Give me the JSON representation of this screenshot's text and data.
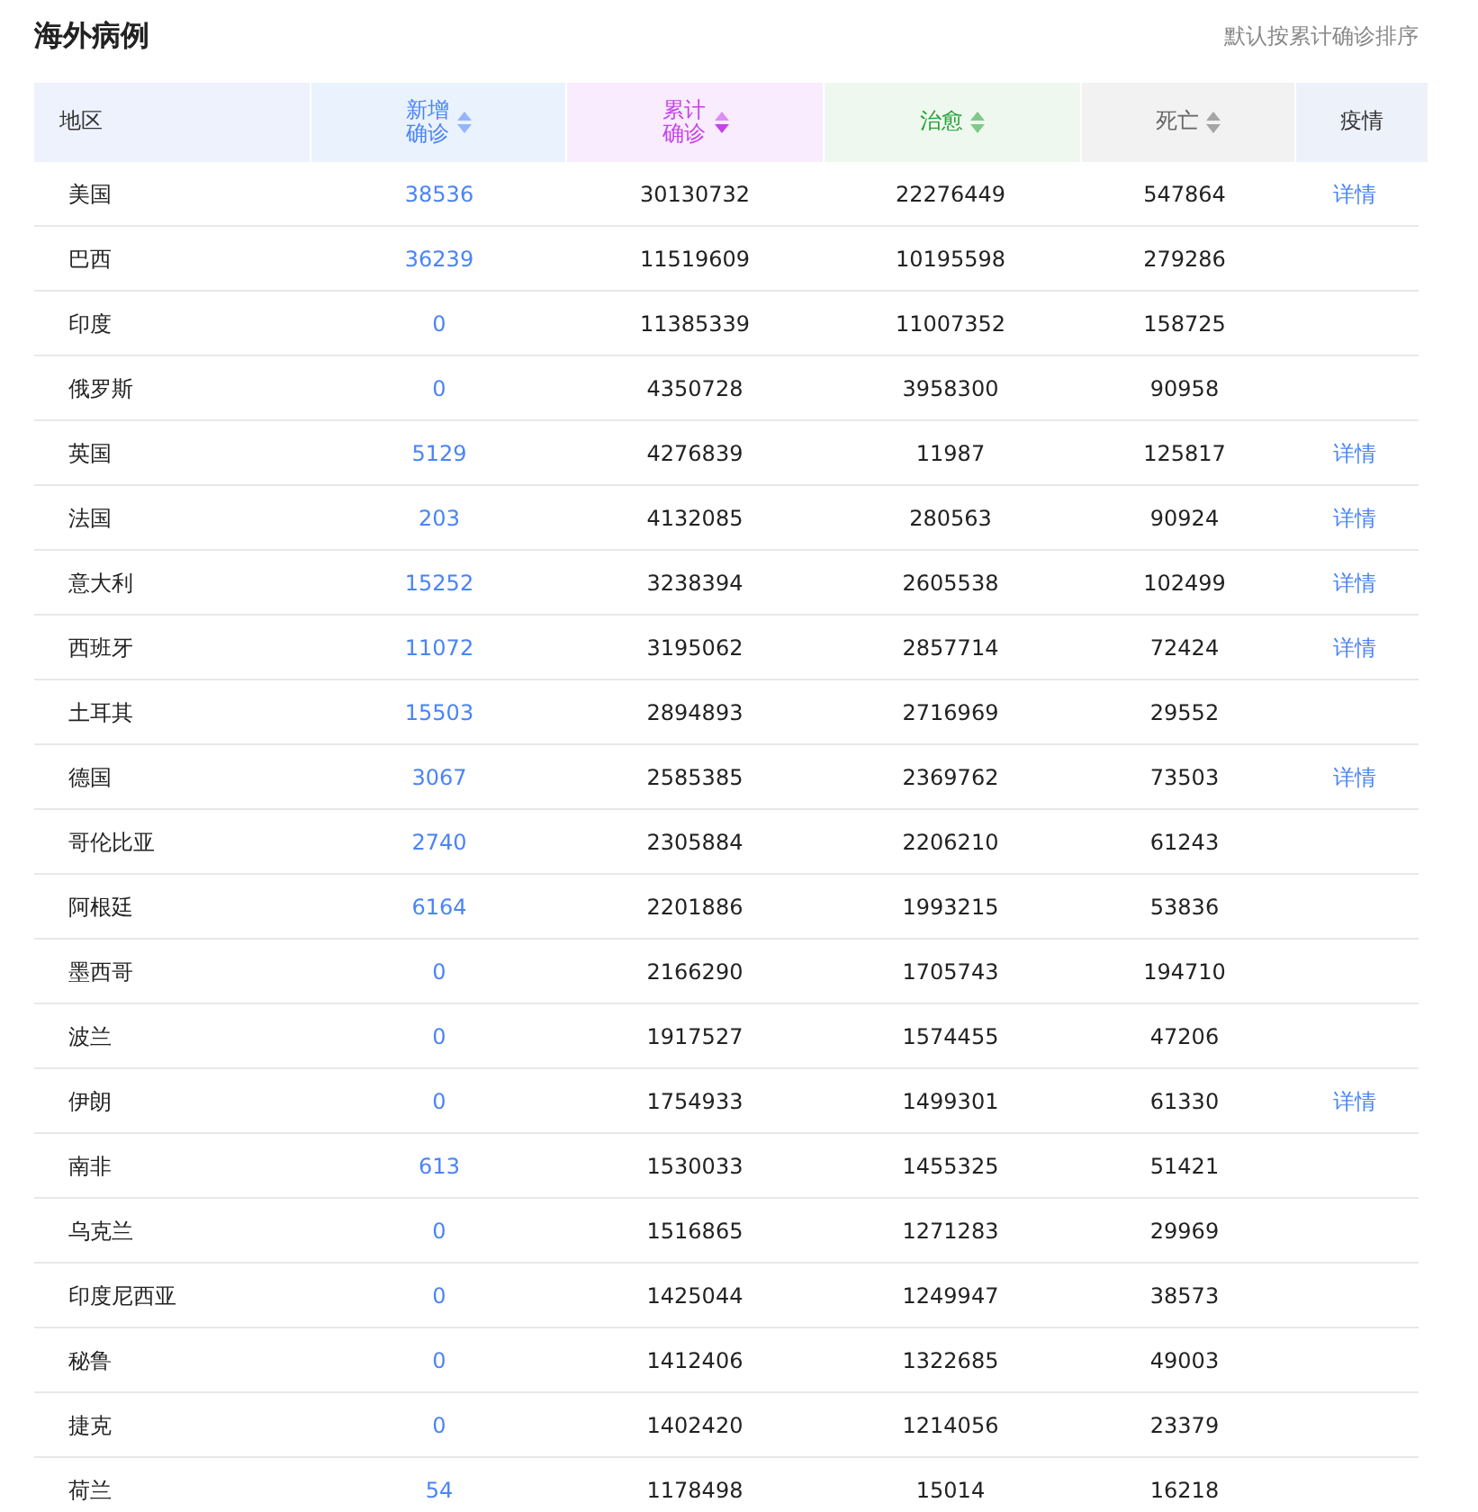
{
  "title": "海外病例",
  "sort_note": "默认按累计确诊排序",
  "columns": [
    {
      "label": "地区",
      "sortable": false,
      "color": "#333333"
    },
    {
      "label": "新增确诊",
      "sortable": true,
      "sorted": false,
      "color": "#4b84f7"
    },
    {
      "label": "累计确诊",
      "sortable": true,
      "sorted": true,
      "color": "#c542ea"
    },
    {
      "label": "治愈",
      "sortable": true,
      "sorted": false,
      "color": "#24a338"
    },
    {
      "label": "死亡",
      "sortable": true,
      "sorted": false,
      "color": "#666666"
    },
    {
      "label": "疫情",
      "sortable": false,
      "color": "#333333"
    }
  ],
  "rows": [
    {
      "region": "美国",
      "new": "38536",
      "total": "30130732",
      "cured": "22276449",
      "dead": "547864",
      "detail": "详情"
    },
    {
      "region": "巴西",
      "new": "36239",
      "total": "11519609",
      "cured": "10195598",
      "dead": "279286"
    },
    {
      "region": "印度",
      "new": "0",
      "total": "11385339",
      "cured": "11007352",
      "dead": "158725"
    },
    {
      "region": "俄罗斯",
      "new": "0",
      "total": "4350728",
      "cured": "3958300",
      "dead": "90958"
    },
    {
      "region": "英国",
      "new": "5129",
      "total": "4276839",
      "cured": "11987",
      "dead": "125817",
      "detail": "详情"
    },
    {
      "region": "法国",
      "new": "203",
      "total": "4132085",
      "cured": "280563",
      "dead": "90924",
      "detail": "详情"
    },
    {
      "region": "意大利",
      "new": "15252",
      "total": "3238394",
      "cured": "2605538",
      "dead": "102499",
      "detail": "详情"
    },
    {
      "region": "西班牙",
      "new": "11072",
      "total": "3195062",
      "cured": "2857714",
      "dead": "72424",
      "detail": "详情"
    },
    {
      "region": "土耳其",
      "new": "15503",
      "total": "2894893",
      "cured": "2716969",
      "dead": "29552"
    },
    {
      "region": "德国",
      "new": "3067",
      "total": "2585385",
      "cured": "2369762",
      "dead": "73503",
      "detail": "详情"
    },
    {
      "region": "哥伦比亚",
      "new": "2740",
      "total": "2305884",
      "cured": "2206210",
      "dead": "61243"
    },
    {
      "region": "阿根廷",
      "new": "6164",
      "total": "2201886",
      "cured": "1993215",
      "dead": "53836"
    },
    {
      "region": "墨西哥",
      "new": "0",
      "total": "2166290",
      "cured": "1705743",
      "dead": "194710"
    },
    {
      "region": "波兰",
      "new": "0",
      "total": "1917527",
      "cured": "1574455",
      "dead": "47206"
    },
    {
      "region": "伊朗",
      "new": "0",
      "total": "1754933",
      "cured": "1499301",
      "dead": "61330",
      "detail": "详情"
    },
    {
      "region": "南非",
      "new": "613",
      "total": "1530033",
      "cured": "1455325",
      "dead": "51421"
    },
    {
      "region": "乌克兰",
      "new": "0",
      "total": "1516865",
      "cured": "1271283",
      "dead": "29969"
    },
    {
      "region": "印度尼西亚",
      "new": "0",
      "total": "1425044",
      "cured": "1249947",
      "dead": "38573"
    },
    {
      "region": "秘鲁",
      "new": "0",
      "total": "1412406",
      "cured": "1322685",
      "dead": "49003"
    },
    {
      "region": "捷克",
      "new": "0",
      "total": "1402420",
      "cured": "1214056",
      "dead": "23379"
    },
    {
      "region": "荷兰",
      "new": "54",
      "total": "1178498",
      "cured": "15014",
      "dead": "16218"
    }
  ]
}
